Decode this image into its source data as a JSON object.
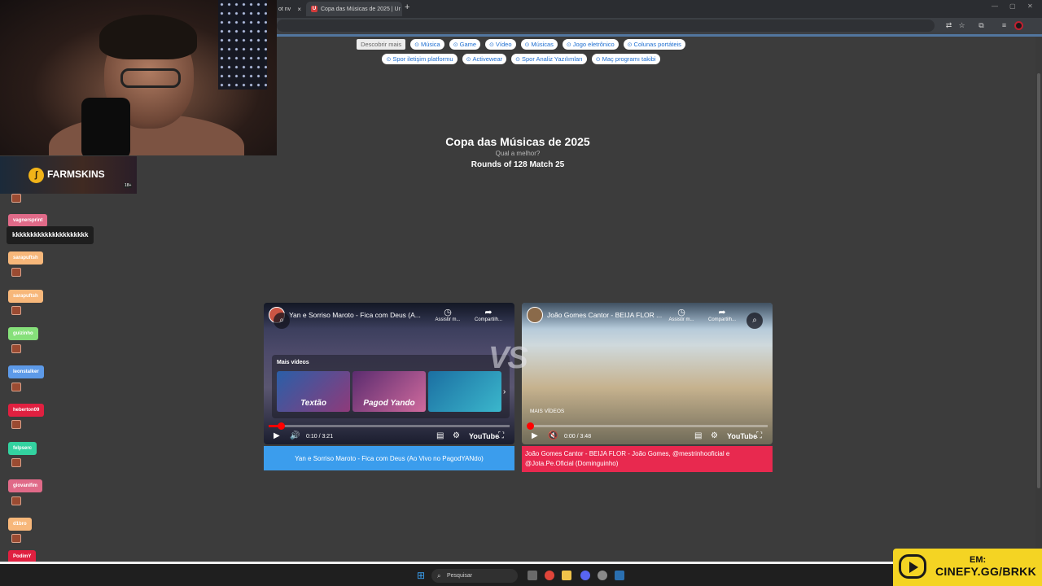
{
  "browser": {
    "tabs": [
      {
        "label": "ot nv",
        "active": false
      },
      {
        "label": "Copa das Músicas de 2025 | Ur",
        "active": true
      }
    ],
    "tab_close": "×",
    "new_tab": "+",
    "window_controls": [
      "—",
      "▢",
      "✕"
    ]
  },
  "page": {
    "discover_label": "Descobrir mais",
    "pills_row1": [
      "Música",
      "Game",
      "Vídeo",
      "Músicas",
      "Jogo eletrônico",
      "Colunas portáteis"
    ],
    "pills_row2": [
      "Spor iletişim platformu",
      "Activewear",
      "Spor Analiz Yazılımları",
      "Maç programı takibi"
    ],
    "title": "Copa das Músicas de 2025",
    "subtitle": "Qual a melhor?",
    "round": "Rounds of 128 Match 25",
    "vs": "VS"
  },
  "videos": [
    {
      "title": "Yan e Sorriso Maroto - Fica com Deus (A...",
      "action_watch": "Assistir m...",
      "action_share": "Compartilh...",
      "more_label": "Mais vídeos",
      "thumbs": [
        "Textão",
        "Pagod Yando",
        ""
      ],
      "time": "0:10 / 3:21",
      "progress": 0.05,
      "brand": "YouTube",
      "button": "Yan e Sorriso Maroto - Fica com Deus (Ao Vivo no PagodYANdo)",
      "color": "#3b9ded"
    },
    {
      "title": "João Gomes Cantor - BEIJA FLOR ...",
      "action_watch": "Assistir m...",
      "action_share": "Compartilh...",
      "more_label": "MAIS VÍDEOS",
      "time": "0:00 / 3:48",
      "progress": 0.0,
      "brand": "YouTube",
      "button": "João Gomes Cantor - BEIJA FLOR - João Gomes, @mestrinhooficial e @Jota.Pe.Oficial (Dominguinho)",
      "color": "#e8294f"
    }
  ],
  "overlay": {
    "sponsor": "FARMSKINS",
    "sponsor_age": "18+",
    "chat": [
      {
        "user": "vagnersprint",
        "color": "#e06a88"
      },
      {
        "user": "sarapuftsh",
        "color": "#f7b77a"
      },
      {
        "user": "sarapuftsh",
        "color": "#f7b77a"
      },
      {
        "user": "guizinho",
        "color": "#86e07a"
      },
      {
        "user": "leonstalker",
        "color": "#5d9ae8"
      },
      {
        "user": "heberton09",
        "color": "#e02040"
      },
      {
        "user": "felpserc",
        "color": "#33d2a0"
      },
      {
        "user": "giovanifim",
        "color": "#e06a88"
      },
      {
        "user": "d1bro",
        "color": "#f7b77a"
      },
      {
        "user": "PodimY",
        "color": "#e02040"
      }
    ],
    "chat_message": "kkkkkkkkkkkkkkkkkkkkk",
    "promo_line1": "EM:",
    "promo_line2": "CINEFY.GG/BRKK"
  },
  "taskbar": {
    "search_placeholder": "Pesquisar"
  }
}
